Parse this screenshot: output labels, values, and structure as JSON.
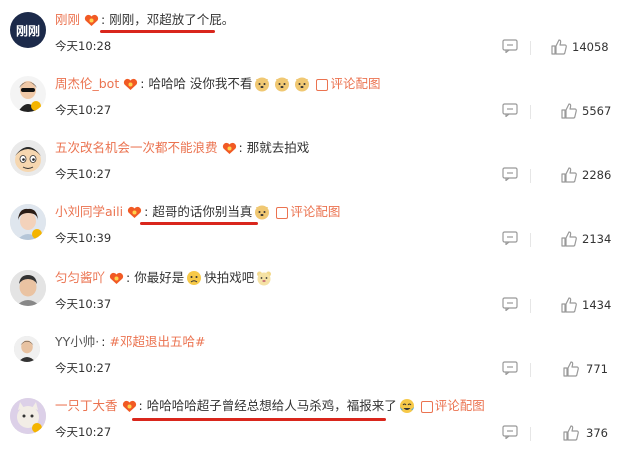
{
  "comments": [
    {
      "username": "刚刚",
      "text": "刚刚，邓超放了个屁。",
      "time": "今天10:28",
      "likes": "14058",
      "avatar": "avatar-gangang",
      "emojis": [],
      "pic_label": "",
      "hashtag": ""
    },
    {
      "username": "周杰伦_bot",
      "text": "哈哈哈 没你我不看",
      "time": "今天10:27",
      "likes": "5567",
      "avatar": "avatar-jay",
      "emojis": [
        "doge-icon",
        "doge-icon",
        "doge-icon"
      ],
      "pic_label": "评论配图",
      "hashtag": ""
    },
    {
      "username": "五次改名机会一次都不能浪费",
      "text": "那就去拍戏",
      "time": "今天10:27",
      "likes": "2286",
      "avatar": "avatar-cartoon",
      "emojis": [],
      "pic_label": "",
      "hashtag": ""
    },
    {
      "username": "小刘同学aili",
      "text": "超哥的话你别当真",
      "time": "今天10:39",
      "likes": "2134",
      "avatar": "avatar-girl",
      "emojis": [
        "doge-icon"
      ],
      "pic_label": "评论配图",
      "hashtag": ""
    },
    {
      "username": "匀匀酱吖",
      "text_a": "你最好是",
      "text_b": "快拍戏吧",
      "time": "今天10:37",
      "likes": "1434",
      "avatar": "avatar-man",
      "emojis": [
        "sad-face-icon",
        "bear-face-icon"
      ],
      "pic_label": "",
      "hashtag": ""
    },
    {
      "username": "YY小帅·",
      "text": "",
      "hashtag": "#邓超退出五哈#",
      "time": "今天10:27",
      "likes": "771",
      "avatar": "avatar-yy",
      "emojis": [],
      "pic_label": ""
    },
    {
      "username": "一只丁大香",
      "text": "哈哈哈哈超子曾经总想给人马杀鸡，福报来了",
      "time": "今天10:27",
      "likes": "376",
      "avatar": "avatar-cat",
      "emojis": [
        "crying-laughing-icon"
      ],
      "pic_label": "评论配图",
      "hashtag": ""
    }
  ],
  "colors": {
    "username": "#eb7350",
    "underline": "#d9261c",
    "icon": "#999999"
  }
}
